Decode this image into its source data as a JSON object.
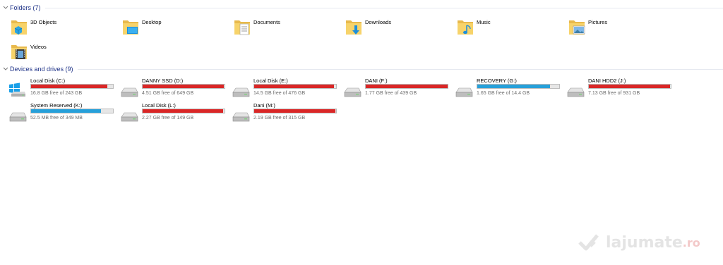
{
  "folders": {
    "title": "Folders (7)",
    "items": [
      {
        "label": "3D Objects",
        "icon": "3d-objects-folder-icon"
      },
      {
        "label": "Desktop",
        "icon": "desktop-folder-icon"
      },
      {
        "label": "Documents",
        "icon": "documents-folder-icon"
      },
      {
        "label": "Downloads",
        "icon": "downloads-folder-icon"
      },
      {
        "label": "Music",
        "icon": "music-folder-icon"
      },
      {
        "label": "Pictures",
        "icon": "pictures-folder-icon"
      },
      {
        "label": "Videos",
        "icon": "videos-folder-icon"
      }
    ]
  },
  "drives": {
    "title": "Devices and drives (9)",
    "items": [
      {
        "label": "Local Disk (C:)",
        "free": "16.8 GB free of 243 GB",
        "used_fraction": 0.93,
        "bar_color": "#da2626",
        "icon": "windows-drive-icon"
      },
      {
        "label": "DANNY SSD (D:)",
        "free": "4.51 GB free of 649 GB",
        "used_fraction": 0.99,
        "bar_color": "#da2626",
        "icon": "hard-drive-icon"
      },
      {
        "label": "Local Disk (E:)",
        "free": "14.5 GB free of 476 GB",
        "used_fraction": 0.97,
        "bar_color": "#da2626",
        "icon": "hard-drive-icon"
      },
      {
        "label": "DANI (F:)",
        "free": "1.77 GB free of 439 GB",
        "used_fraction": 0.996,
        "bar_color": "#da2626",
        "icon": "hard-drive-icon"
      },
      {
        "label": "RECOVERY (G:)",
        "free": "1.65 GB free of 14.4 GB",
        "used_fraction": 0.89,
        "bar_color": "#26a0da",
        "icon": "hard-drive-icon"
      },
      {
        "label": "DANI HDD2 (J:)",
        "free": "7.13 GB free of 931 GB",
        "used_fraction": 0.99,
        "bar_color": "#da2626",
        "icon": "hard-drive-icon"
      },
      {
        "label": "System Reserved (K:)",
        "free": "52.5 MB free of 349 MB",
        "used_fraction": 0.85,
        "bar_color": "#26a0da",
        "icon": "hard-drive-icon"
      },
      {
        "label": "Local Disk (L:)",
        "free": "2.27 GB free of 149 GB",
        "used_fraction": 0.985,
        "bar_color": "#da2626",
        "icon": "hard-drive-icon"
      },
      {
        "label": "Dani (M:)",
        "free": "2.19 GB free of 315 GB",
        "used_fraction": 0.993,
        "bar_color": "#da2626",
        "icon": "hard-drive-icon"
      }
    ]
  },
  "watermark": {
    "text": "lajumate",
    "suffix": ".ro"
  }
}
